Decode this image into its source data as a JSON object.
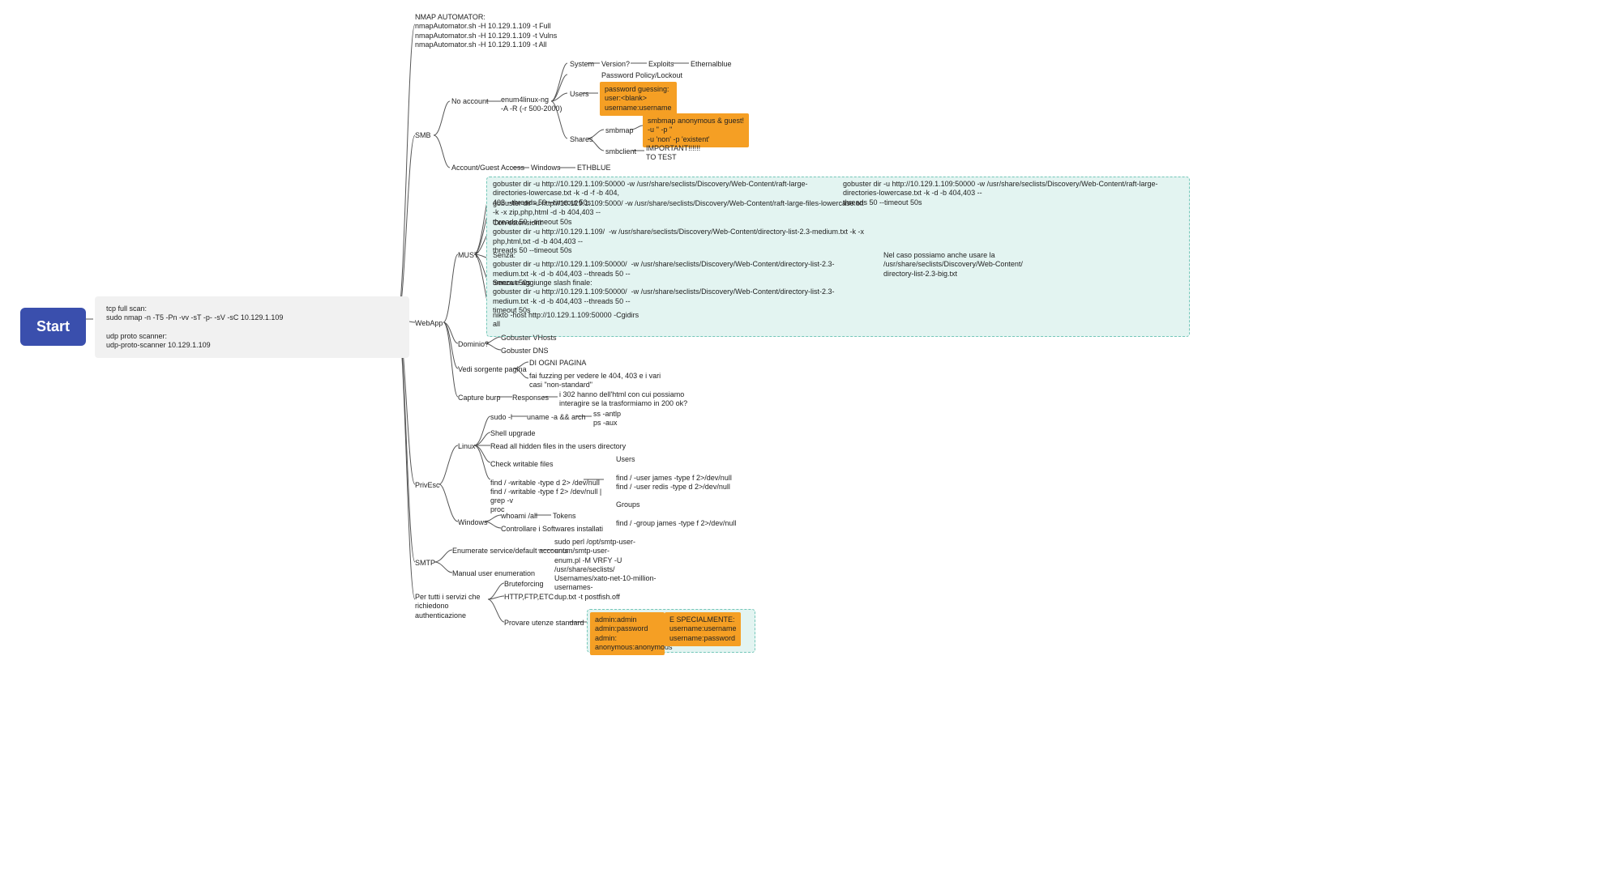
{
  "start": "Start",
  "scan": "tcp full scan:\nsudo nmap -n -T5 -Pn -vv -sT -p- -sV -sC 10.129.1.109\n\nudp proto scanner:\nudp-proto-scanner 10.129.1.109",
  "nmapauto": "NMAP AUTOMATOR:\nnmapAutomator.sh -H 10.129.1.109 -t Full\nnmapAutomator.sh -H 10.129.1.109 -t Vulns\nnmapAutomator.sh -H 10.129.1.109 -t All",
  "smb": "SMB",
  "noacct": "No account",
  "enum4": "enum4linux-ng\n-A -R (-r 500-2000)",
  "system": "System",
  "version": "Version?",
  "exploits": "Exploits",
  "eternal": "Ethernalblue",
  "passpol": "Password Policy/Lockout",
  "users": "Users",
  "pwdguess": "password guessing:\nuser:<blank>\nusername:username",
  "shares": "Shares",
  "smbmap": "smbmap",
  "smbmapbox": "smbmap anonymous & guest!\n-u '' -p ''\n-u 'non' -p 'existent'",
  "smbclient": "smbclient",
  "important": "IMPORTANT!!!!!!\nTO TEST",
  "acctguest": "Account/Guest Access",
  "windows": "Windows",
  "ethblue": "ETHBLUE",
  "webapp": "WebApp",
  "must": "MUST",
  "gob1": "gobuster dir -u http://10.129.1.109:50000 -w /usr/share/seclists/Discovery/Web-Content/raft-large-directories-lowercase.txt -k -d -f -b 404,\n403 --threads 50 --timeout 50s",
  "gob1r": "gobuster dir -u http://10.129.1.109:50000 -w /usr/share/seclists/Discovery/Web-Content/raft-large-directories-lowercase.txt -k -d -b 404,403 --\nthreads 50 --timeout 50s",
  "gob2": "gobuster dir -u http://10.129.1.109:5000/ -w /usr/share/seclists/Discovery/Web-Content/raft-large-files-lowercase.txt -k -x zip,php,html -d -b 404,403 --\nthreads 50 --timeout 50s",
  "gob3": "Con estensioni:\ngobuster dir -u http://10.129.1.109/  -w /usr/share/seclists/Discovery/Web-Content/directory-list-2.3-medium.txt -k -x php,html,txt -d -b 404,403 --\nthreads 50 --timeout 50s",
  "gob4": "Senza:\ngobuster dir -u http://10.129.1.109:50000/  -w /usr/share/seclists/Discovery/Web-Content/directory-list-2.3-medium.txt -k -d -b 404,403 --threads 50 --\ntimeout 50s",
  "gob4r": "Nel caso possiamo anche usare la\n/usr/share/seclists/Discovery/Web-Content/\ndirectory-list-2.3-big.txt",
  "gob5": "Senza e aggiunge slash finale:\ngobuster dir -u http://10.129.1.109:50000/  -w /usr/share/seclists/Discovery/Web-Content/directory-list-2.3-medium.txt -k -d -b 404,403 --threads 50 --\ntimeout 50s",
  "nikto": "nikto -host http://10.129.1.109:50000 -Cgidirs\nall",
  "dominio": "Dominio?",
  "gvhosts": "Gobuster VHosts",
  "gdns": "Gobuster DNS",
  "vedi": "Vedi sorgente pagina",
  "pagina": "DI OGNI PAGINA",
  "fuzzing": "fai fuzzing per vedere le 404, 403 e i vari\ncasi \"non-standard\"",
  "capture": "Capture burp",
  "responses": "Responses",
  "resp302": "i 302 hanno dell'html con cui possiamo\ninteragire se la trasformiamo in 200 ok?",
  "privesc": "PrivEsc",
  "linux": "Linux",
  "sudo": "sudo -l",
  "uname": "uname -a && arch",
  "ssps": "ss -antlp\nps -aux",
  "shellup": "Shell upgrade",
  "hidden": "Read all hidden files in the users directory",
  "writable": "Check writable files\n\nfind / -writable -type d 2> /dev/null\nfind / -writable -type f 2> /dev/null | grep -v\nproc",
  "usersgroups": "Users\n\nfind / -user james -type f 2>/dev/null\nfind / -user redis -type d 2>/dev/null\n\nGroups\n\nfind / -group james -type f 2>/dev/null",
  "winpriv": "Windows",
  "whoami": "whoami /all",
  "tokens": "Tokens",
  "software": "Controllare i Softwares installati",
  "smtp": "SMTP",
  "enumdef": "Enumerate service/default accounts",
  "smtpenum": "sudo perl /opt/smtp-user-enum/smtp-user-\nenum.pl -M VRFY -U /usr/share/seclists/\nUsernames/xato-net-10-million-usernames-\ndup.txt -t postfish.off",
  "manual": "Manual user enumeration",
  "servizi": "Per tutti i servizi che richiedono\nauthenticazione",
  "brute": "Bruteforcing",
  "httpftp": "HTTP,FTP,ETC",
  "provare": "Provare utenze standard",
  "creds": "admin:admin\nadmin:password\nadmin:\nanonymous:anonymous",
  "especial": "E SPECIALMENTE:\nusername:username\nusername:password"
}
